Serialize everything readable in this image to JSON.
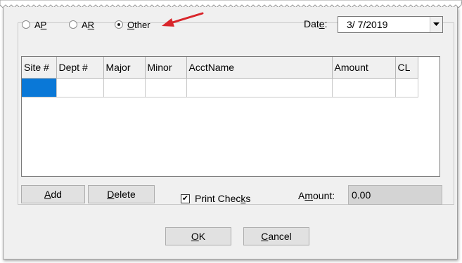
{
  "options": [
    {
      "label_pre": "A",
      "label_ul": "P",
      "label_post": "",
      "selected": false
    },
    {
      "label_pre": "A",
      "label_ul": "R",
      "label_post": "",
      "selected": false
    },
    {
      "label_pre": "",
      "label_ul": "O",
      "label_post": "ther",
      "selected": true
    }
  ],
  "date": {
    "label_pre": "Dat",
    "label_ul": "e",
    "label_post": ":",
    "value": "3/  7/2019"
  },
  "grid": {
    "columns": [
      "Site #",
      "Dept #",
      "Major",
      "Minor",
      "AcctName",
      "Amount",
      "CL"
    ]
  },
  "buttons": {
    "add": {
      "ul": "A",
      "rest": "dd"
    },
    "delete": {
      "ul": "D",
      "rest": "elete"
    },
    "ok": {
      "ul": "O",
      "rest": "K"
    },
    "cancel": {
      "ul": "C",
      "rest": "ancel"
    }
  },
  "print_checks": {
    "pre": "Print Chec",
    "ul": "k",
    "post": "s",
    "checked": true
  },
  "amount": {
    "pre": "A",
    "ul": "m",
    "post": "ount:",
    "value": "0.00"
  },
  "colors": {
    "selection": "#0a78d7",
    "arrow": "#d9262b"
  }
}
